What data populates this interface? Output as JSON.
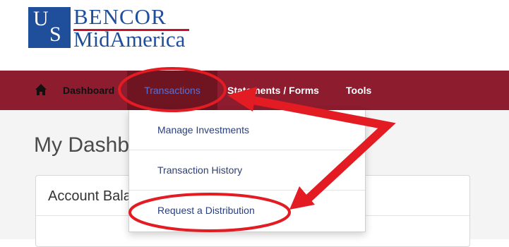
{
  "logo": {
    "initials_u": "U",
    "initials_s": "S",
    "line1": "BENCOR",
    "line2": "MidAmerica"
  },
  "nav": {
    "home_icon": "home-icon",
    "items": [
      {
        "label": "Dashboard"
      },
      {
        "label": "Transactions"
      },
      {
        "label": "Statements / Forms"
      },
      {
        "label": "Tools"
      }
    ]
  },
  "main": {
    "title": "My Dashboard",
    "card_title": "Account Balance"
  },
  "dropdown": {
    "items": [
      {
        "label": "Manage Investments"
      },
      {
        "label": "Transaction History"
      },
      {
        "label": "Request a Distribution"
      }
    ]
  },
  "colors": {
    "nav_bg": "#8c1c2e",
    "brand_blue": "#1f4e9b",
    "annotation_red": "#e31b23"
  }
}
